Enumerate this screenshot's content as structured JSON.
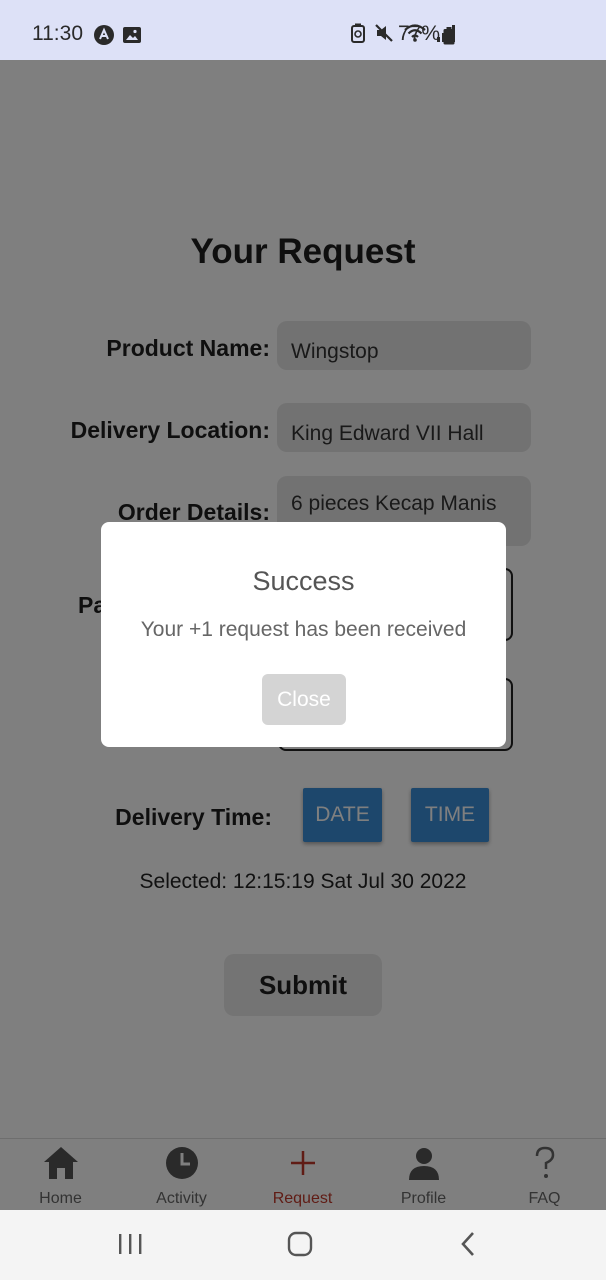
{
  "status_bar": {
    "time": "11:30",
    "battery": "77%"
  },
  "page": {
    "title": "Your Request"
  },
  "form": {
    "product_name_label": "Product Name:",
    "product_name_value": "Wingstop",
    "delivery_location_label": "Delivery Location:",
    "delivery_location_value": "King Edward VII Hall",
    "order_details_label": "Order Details:",
    "order_details_value": "6 pieces Kecap Manis",
    "partial_label": "Pa",
    "delivery_time_label": "Delivery Time:",
    "date_button": "DATE",
    "time_button": "TIME",
    "selected_text": "Selected: 12:15:19 Sat Jul 30 2022",
    "submit_button": "Submit"
  },
  "modal": {
    "title": "Success",
    "message": "Your +1 request has been received",
    "close_button": "Close"
  },
  "tab_bar": {
    "active_color": "#c0392b",
    "items": [
      {
        "label": "Home",
        "icon": "home-icon"
      },
      {
        "label": "Activity",
        "icon": "clock-icon"
      },
      {
        "label": "Request",
        "icon": "plus-icon"
      },
      {
        "label": "Profile",
        "icon": "person-icon"
      },
      {
        "label": "FAQ",
        "icon": "question-icon"
      }
    ]
  },
  "nav_bar": {
    "icons": [
      "recents-icon",
      "home-nav-icon",
      "back-icon"
    ]
  }
}
